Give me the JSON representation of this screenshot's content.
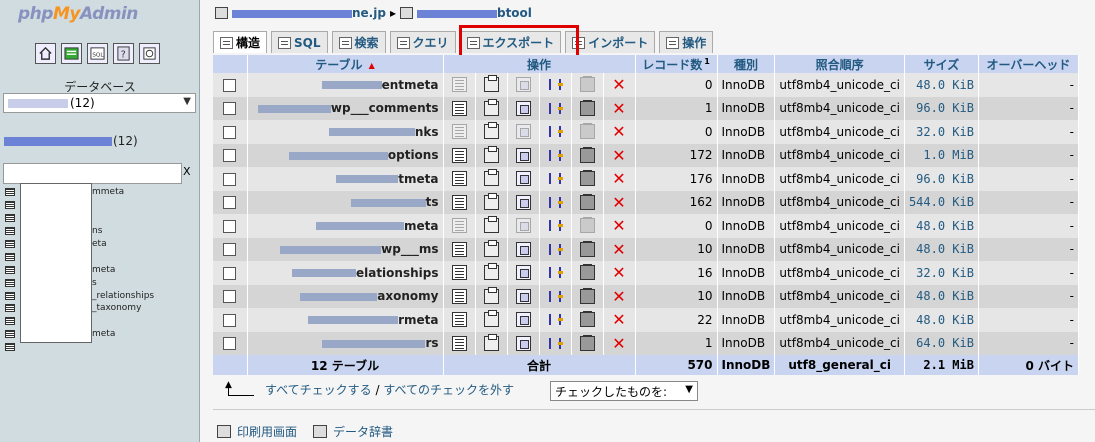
{
  "app": {
    "logo_php": "php",
    "logo_my": "My",
    "logo_admin": "Admin"
  },
  "sidebar": {
    "icons": [
      "home-icon",
      "query-window-icon",
      "sql-docs-icon",
      "docs-icon",
      "changelog-icon"
    ],
    "database_label": "データベース",
    "db_select_value": "(12)",
    "db_name_suffix": "(12)",
    "filter_clear": "X",
    "tree_items": [
      "mmeta",
      "",
      "",
      "ns",
      "eta",
      "",
      "meta",
      "s",
      "_relationships",
      "_taxonomy",
      "",
      "meta",
      ""
    ]
  },
  "breadcrumb": {
    "server_suffix": "ne.jp",
    "separator": "▸",
    "db_suffix": "btool"
  },
  "tabs": [
    {
      "label": "構造",
      "active": true
    },
    {
      "label": "SQL",
      "active": false
    },
    {
      "label": "検索",
      "active": false
    },
    {
      "label": "クエリ",
      "active": false
    },
    {
      "label": "エクスポート",
      "active": false
    },
    {
      "label": "インポート",
      "active": false
    },
    {
      "label": "操作",
      "active": false
    }
  ],
  "table": {
    "headers": {
      "table": "テーブル",
      "actions": "操作",
      "records": "レコード数",
      "records_note": "1",
      "type": "種別",
      "collation": "照合順序",
      "size": "サイズ",
      "overhead": "オーバーヘッド"
    },
    "rows": [
      {
        "name": "entmeta",
        "records": "0",
        "type": "InnoDB",
        "collation": "utf8mb4_unicode_ci",
        "size": "48.0 KiB",
        "overhead": "-",
        "empty": true
      },
      {
        "name": "wp___comments",
        "records": "1",
        "type": "InnoDB",
        "collation": "utf8mb4_unicode_ci",
        "size": "96.0 KiB",
        "overhead": "-",
        "empty": false
      },
      {
        "name": "nks",
        "records": "0",
        "type": "InnoDB",
        "collation": "utf8mb4_unicode_ci",
        "size": "32.0 KiB",
        "overhead": "-",
        "empty": true
      },
      {
        "name": "options",
        "records": "172",
        "type": "InnoDB",
        "collation": "utf8mb4_unicode_ci",
        "size": "1.0 MiB",
        "overhead": "-",
        "empty": false
      },
      {
        "name": "tmeta",
        "records": "176",
        "type": "InnoDB",
        "collation": "utf8mb4_unicode_ci",
        "size": "96.0 KiB",
        "overhead": "-",
        "empty": false
      },
      {
        "name": "ts",
        "records": "162",
        "type": "InnoDB",
        "collation": "utf8mb4_unicode_ci",
        "size": "544.0 KiB",
        "overhead": "-",
        "empty": false
      },
      {
        "name": "meta",
        "records": "0",
        "type": "InnoDB",
        "collation": "utf8mb4_unicode_ci",
        "size": "48.0 KiB",
        "overhead": "-",
        "empty": true
      },
      {
        "name": "wp___ms",
        "records": "10",
        "type": "InnoDB",
        "collation": "utf8mb4_unicode_ci",
        "size": "48.0 KiB",
        "overhead": "-",
        "empty": false
      },
      {
        "name": "elationships",
        "records": "16",
        "type": "InnoDB",
        "collation": "utf8mb4_unicode_ci",
        "size": "32.0 KiB",
        "overhead": "-",
        "empty": false
      },
      {
        "name": "axonomy",
        "records": "10",
        "type": "InnoDB",
        "collation": "utf8mb4_unicode_ci",
        "size": "48.0 KiB",
        "overhead": "-",
        "empty": false
      },
      {
        "name": "rmeta",
        "records": "22",
        "type": "InnoDB",
        "collation": "utf8mb4_unicode_ci",
        "size": "48.0 KiB",
        "overhead": "-",
        "empty": false
      },
      {
        "name": "rs",
        "records": "1",
        "type": "InnoDB",
        "collation": "utf8mb4_unicode_ci",
        "size": "64.0 KiB",
        "overhead": "-",
        "empty": false
      }
    ],
    "footer": {
      "tables_count": "12 テーブル",
      "total_label": "合計",
      "records": "570",
      "type": "InnoDB",
      "collation": "utf8_general_ci",
      "size": "2.1 MiB",
      "overhead": "0 バイト"
    }
  },
  "bulk": {
    "check_all": "すべてチェックする",
    "separator": " / ",
    "uncheck_all": "すべてのチェックを外す",
    "with_selected": "チェックしたものを:"
  },
  "bottom": {
    "print_view": "印刷用画面",
    "data_dictionary": "データ辞書"
  },
  "colors": {
    "highlight": "#e00000",
    "link": "#235a81",
    "header_bg": "#c8d4f0"
  }
}
